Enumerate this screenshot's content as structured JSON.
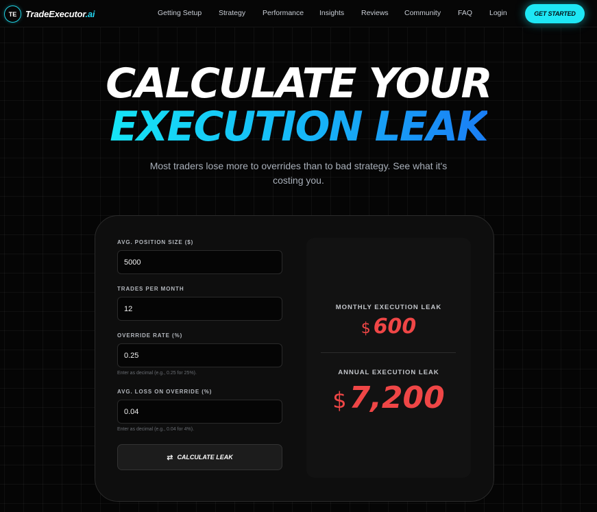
{
  "nav": {
    "logo_badge": "TE",
    "logo_name": "TradeExecutor",
    "logo_suffix": ".ai",
    "links": [
      "Getting Setup",
      "Strategy",
      "Performance",
      "Insights",
      "Reviews",
      "Community",
      "FAQ",
      "Login"
    ],
    "cta_label": "GET STARTED"
  },
  "hero": {
    "line1": "CALCULATE YOUR",
    "line2": "EXECUTION LEAK",
    "subtitle": "Most traders lose more to overrides than to bad strategy. See what it's costing you."
  },
  "form": {
    "position_size": {
      "label": "AVG. POSITION SIZE ($)",
      "value": "5000"
    },
    "trades_per_month": {
      "label": "TRADES PER MONTH",
      "value": "12"
    },
    "override_rate": {
      "label": "OVERRIDE RATE (%)",
      "value": "0.25",
      "hint": "Enter as decimal (e.g., 0.25 for 25%)."
    },
    "avg_loss": {
      "label": "AVG. LOSS ON OVERRIDE (%)",
      "value": "0.04",
      "hint": "Enter as decimal (e.g., 0.04 for 4%)."
    },
    "button_label": "CALCULATE LEAK"
  },
  "results": {
    "currency": "$",
    "monthly_label": "MONTHLY EXECUTION LEAK",
    "monthly_value": "600",
    "annual_label": "ANNUAL EXECUTION LEAK",
    "annual_value": "7,200"
  },
  "colors": {
    "accent": "#1ee7f5",
    "loss": "#ef4646"
  }
}
